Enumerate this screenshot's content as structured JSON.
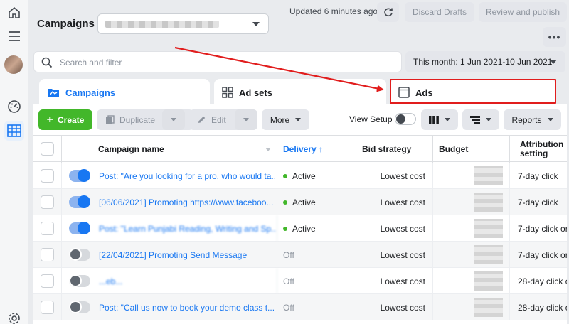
{
  "header": {
    "title": "Campaigns",
    "updated": "Updated 6 minutes ago",
    "discard": "Discard Drafts",
    "review": "Review and publish",
    "more_dots": "•••"
  },
  "search": {
    "placeholder": "Search and filter"
  },
  "date_range": "This month: 1 Jun 2021-10 Jun 2021",
  "tabs": [
    {
      "label": "Campaigns",
      "icon": "folder-icon"
    },
    {
      "label": "Ad sets",
      "icon": "grid-icon"
    },
    {
      "label": "Ads",
      "icon": "ad-frame-icon"
    }
  ],
  "toolbar": {
    "create": "Create",
    "duplicate": "Duplicate",
    "edit": "Edit",
    "more": "More",
    "view_setup": "View Setup",
    "reports": "Reports"
  },
  "table": {
    "columns": {
      "name": "Campaign name",
      "delivery": "Delivery ↑",
      "bid": "Bid strategy",
      "budget": "Budget",
      "attribution_1": "Attribution",
      "attribution_2": "setting"
    },
    "rows": [
      {
        "name": "Post: \"Are you looking for a pro, who would ta...",
        "delivery": "Active",
        "bid": "Lowest cost",
        "attribution": "7-day click",
        "on": true
      },
      {
        "name": "[06/06/2021] Promoting https://www.faceboo...",
        "delivery": "Active",
        "bid": "Lowest cost",
        "attribution": "7-day click",
        "on": true
      },
      {
        "name": "Post: \"Learn Punjabi Reading, Writing and Sp...",
        "delivery": "Active",
        "bid": "Lowest cost",
        "attribution": "7-day click or",
        "on": true
      },
      {
        "name": "[22/04/2021] Promoting Send Message",
        "delivery": "Off",
        "bid": "Lowest cost",
        "attribution": "7-day click or",
        "on": false
      },
      {
        "name": "...eb...",
        "delivery": "Off",
        "bid": "Lowest cost",
        "attribution": "28-day click o",
        "on": false
      },
      {
        "name": "Post: \"Call us now to book your demo class t...",
        "delivery": "Off",
        "bid": "Lowest cost",
        "attribution": "28-day click o",
        "on": false
      }
    ]
  },
  "colors": {
    "accent": "#1877f2",
    "create": "#42b72a",
    "annotation": "#e11d1d"
  }
}
